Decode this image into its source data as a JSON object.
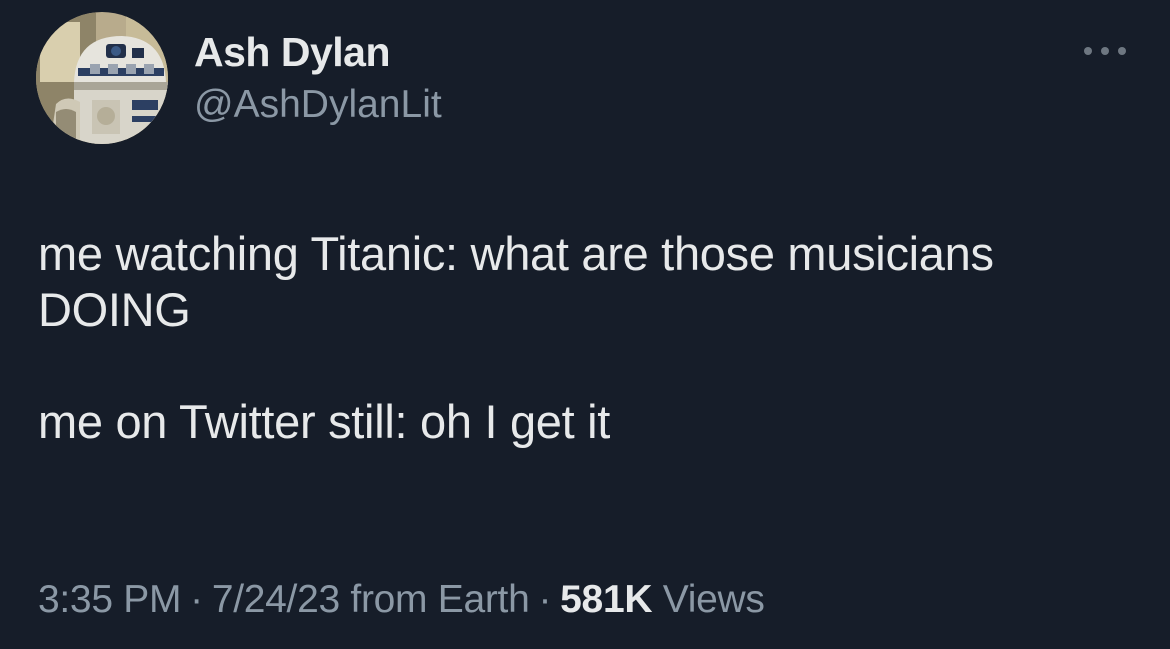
{
  "author": {
    "display_name": "Ash Dylan",
    "handle": "@AshDylanLit",
    "avatar": "r2-d2-avatar"
  },
  "tweet": {
    "paragraphs": [
      "me watching Titanic: what are those musicians\nDOING",
      "me on Twitter still: oh I get it"
    ]
  },
  "meta": {
    "time": "3:35 PM",
    "separator": "·",
    "date": "7/24/23",
    "source": "from Earth",
    "views_count": "581K",
    "views_label": "Views"
  },
  "icons": {
    "more": "more-horizontal-icon"
  },
  "colors": {
    "background": "#161d29",
    "primary_text": "#e7e9ea",
    "secondary_text": "#8b98a5"
  }
}
